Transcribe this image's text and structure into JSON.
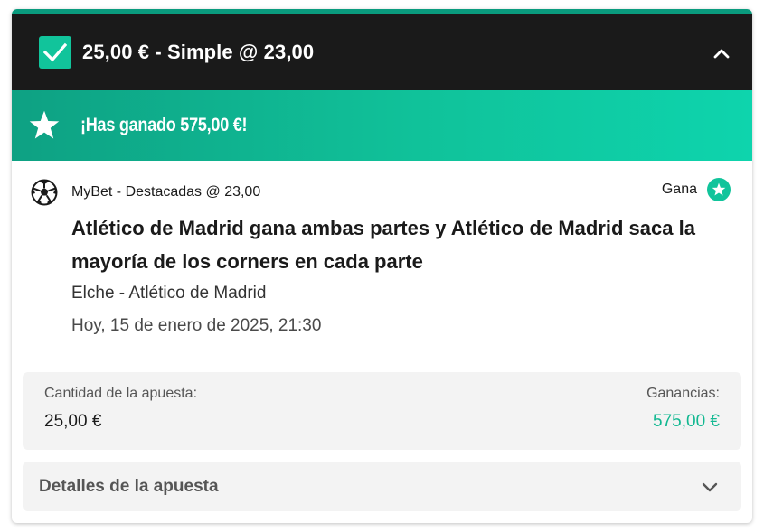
{
  "bet": {
    "header_title": "25,00 € - Simple @ 23,00",
    "win_message": "¡Has ganado 575,00 €!"
  },
  "selection": {
    "market": "MyBet - Destacadas @ 23,00",
    "result_label": "Gana",
    "title": "Atlético de Madrid gana ambas partes y Atlético de Madrid saca la mayoría de los corners en cada parte",
    "event": "Elche - Atlético de Madrid",
    "datetime": "Hoy, 15 de enero de 2025, 21:30"
  },
  "amounts": {
    "stake_label": "Cantidad de la apuesta:",
    "stake_value": "25,00 €",
    "winnings_label": "Ganancias:",
    "winnings_value": "575,00 €"
  },
  "details": {
    "label": "Detalles de la apuesta"
  },
  "icons": {
    "checkbox": "checkbox-checked-icon",
    "collapse": "chevron-up-icon",
    "win": "star-icon",
    "sport": "soccer-ball-icon",
    "result": "star-badge-icon",
    "expand": "chevron-down-icon"
  },
  "colors": {
    "accent_green": "#11c49b",
    "header_bg": "#1a1a1a",
    "winnings_text": "#11b891"
  }
}
